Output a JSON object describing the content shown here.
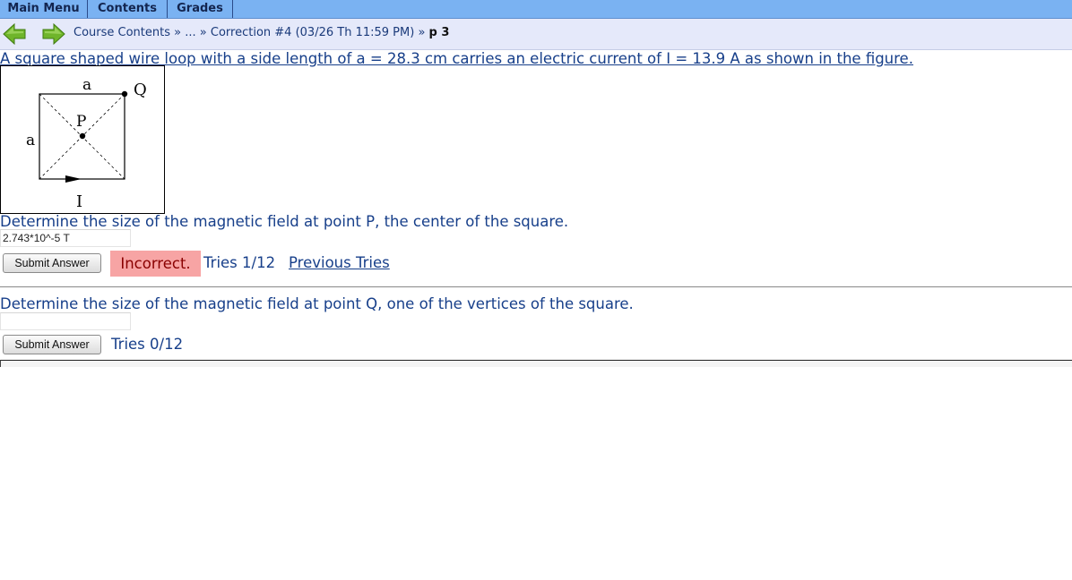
{
  "menu": {
    "main_menu": "Main Menu",
    "contents": "Contents",
    "grades": "Grades"
  },
  "nav": {
    "back_icon": "left-arrow-icon",
    "forward_icon": "right-arrow-icon",
    "breadcrumb": {
      "course_contents": "Course Contents",
      "ellipsis": "...",
      "assignment": "Correction #4 (03/26 Th 11:59 PM)",
      "current": "p 3",
      "separator": "»"
    }
  },
  "problem": {
    "intro": "A square shaped wire loop with a side length of a = 28.3 cm carries an electric current of I = 13.9 A as shown in the figure.",
    "figure": {
      "top_label": "a",
      "side_label": "a",
      "point_p": "P",
      "point_q": "Q",
      "current_label": "I"
    },
    "part1": {
      "question": "Determine the size of the magnetic field at point P, the center of the square.",
      "answer": "2.743*10^-5 T",
      "submit_label": "Submit Answer",
      "status": "Incorrect.",
      "tries": "Tries 1/12",
      "previous_tries": "Previous Tries"
    },
    "part2": {
      "question": "Determine the size of the magnetic field at point Q, one of the vertices of the square.",
      "answer": "",
      "submit_label": "Submit Answer",
      "tries": "Tries 0/12"
    }
  },
  "colors": {
    "menubar": "#7ab2f2",
    "navbar": "#e5e9fa",
    "text": "#173f8a",
    "incorrect_bg": "#f7a4a4",
    "incorrect_text": "#8a0000",
    "arrow_green": "#6fb52a"
  }
}
